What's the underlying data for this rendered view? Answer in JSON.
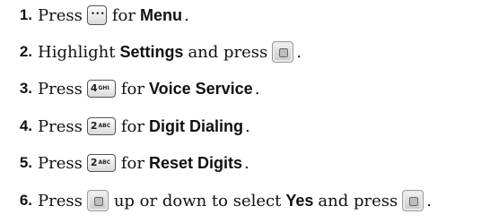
{
  "steps": [
    {
      "num": "1.",
      "parts": [
        {
          "t": "text",
          "v": "Press"
        },
        {
          "t": "key",
          "k": "menu",
          "icon": "menu-key-icon"
        },
        {
          "t": "text",
          "v": "for"
        },
        {
          "t": "bold",
          "v": "Menu"
        },
        {
          "t": "text",
          "v": "."
        }
      ]
    },
    {
      "num": "2.",
      "parts": [
        {
          "t": "text",
          "v": "Highlight"
        },
        {
          "t": "bold",
          "v": "Settings"
        },
        {
          "t": "text",
          "v": "and press"
        },
        {
          "t": "key",
          "k": "ok",
          "icon": "ok-key-icon"
        },
        {
          "t": "text",
          "v": "."
        }
      ]
    },
    {
      "num": "3.",
      "parts": [
        {
          "t": "text",
          "v": "Press"
        },
        {
          "t": "key",
          "k": "num",
          "digit": "4",
          "letters": "GHI",
          "icon": "key-4-icon"
        },
        {
          "t": "text",
          "v": "for"
        },
        {
          "t": "bold",
          "v": "Voice Service"
        },
        {
          "t": "text",
          "v": "."
        }
      ]
    },
    {
      "num": "4.",
      "parts": [
        {
          "t": "text",
          "v": "Press"
        },
        {
          "t": "key",
          "k": "num",
          "digit": "2",
          "letters": "ABC",
          "icon": "key-2-icon"
        },
        {
          "t": "text",
          "v": "for"
        },
        {
          "t": "bold",
          "v": "Digit Dialing"
        },
        {
          "t": "text",
          "v": "."
        }
      ]
    },
    {
      "num": "5.",
      "parts": [
        {
          "t": "text",
          "v": "Press"
        },
        {
          "t": "key",
          "k": "num",
          "digit": "2",
          "letters": "ABC",
          "icon": "key-2-icon"
        },
        {
          "t": "text",
          "v": "for"
        },
        {
          "t": "bold",
          "v": "Reset Digits"
        },
        {
          "t": "text",
          "v": "."
        }
      ]
    },
    {
      "num": "6.",
      "parts": [
        {
          "t": "text",
          "v": "Press"
        },
        {
          "t": "key",
          "k": "ok",
          "icon": "navigation-key-icon"
        },
        {
          "t": "text",
          "v": "up or down to select"
        },
        {
          "t": "bold",
          "v": "Yes"
        },
        {
          "t": "text",
          "v": "and press"
        },
        {
          "t": "key",
          "k": "ok",
          "icon": "ok-key-icon"
        },
        {
          "t": "text",
          "v": "."
        }
      ]
    }
  ]
}
